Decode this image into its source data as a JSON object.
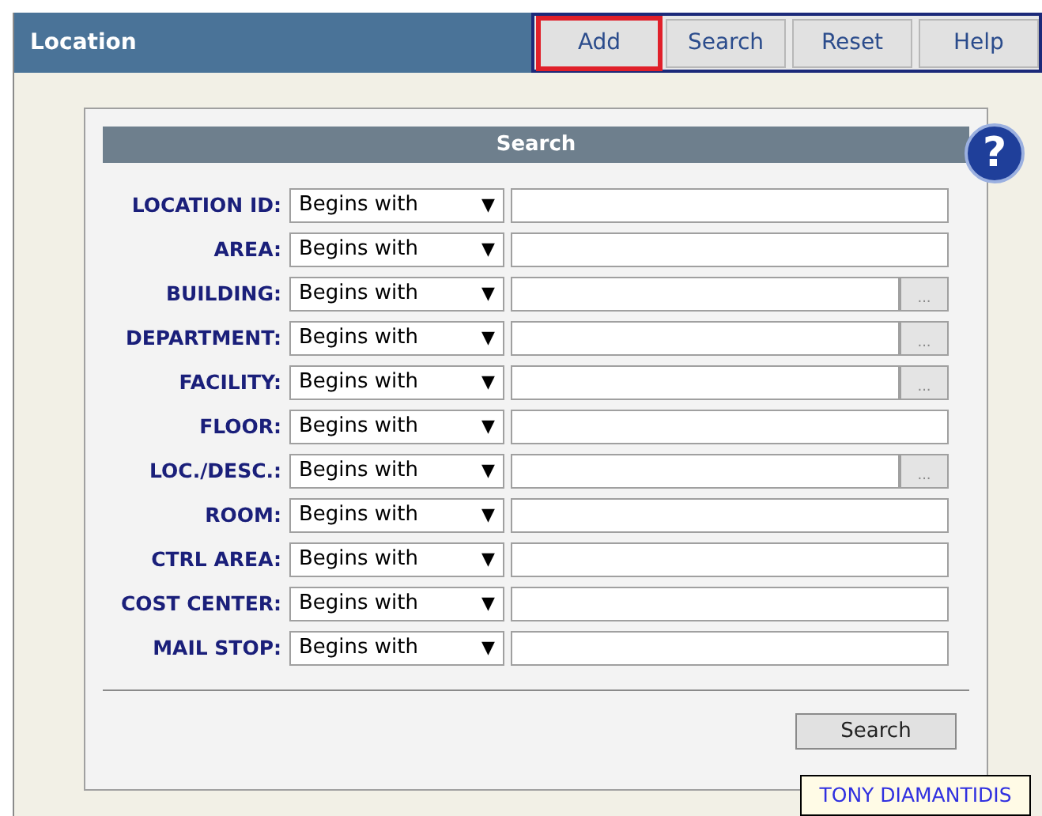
{
  "window": {
    "title": "Location"
  },
  "toolbar": [
    {
      "label": "Add",
      "highlighted": true
    },
    {
      "label": "Search",
      "highlighted": false
    },
    {
      "label": "Reset",
      "highlighted": false
    },
    {
      "label": "Help",
      "highlighted": false
    }
  ],
  "panel": {
    "title": "Search",
    "fields": [
      {
        "label": "LOCATION ID:",
        "operator": "Begins with",
        "lookup": false
      },
      {
        "label": "AREA:",
        "operator": "Begins with",
        "lookup": false
      },
      {
        "label": "BUILDING:",
        "operator": "Begins with",
        "lookup": true,
        "lookup_label": "..."
      },
      {
        "label": "DEPARTMENT:",
        "operator": "Begins with",
        "lookup": true,
        "lookup_label": "..."
      },
      {
        "label": "FACILITY:",
        "operator": "Begins with",
        "lookup": true,
        "lookup_label": "..."
      },
      {
        "label": "FLOOR:",
        "operator": "Begins with",
        "lookup": false
      },
      {
        "label": "LOC./DESC.:",
        "operator": "Begins with",
        "lookup": true,
        "lookup_label": "..."
      },
      {
        "label": "ROOM:",
        "operator": "Begins with",
        "lookup": false
      },
      {
        "label": "CTRL AREA:",
        "operator": "Begins with",
        "lookup": false
      },
      {
        "label": "COST CENTER:",
        "operator": "Begins with",
        "lookup": false
      },
      {
        "label": "MAIL STOP:",
        "operator": "Begins with",
        "lookup": false
      }
    ],
    "dropdown_arrow": "▼",
    "search_button": "Search"
  },
  "help_icon": "?",
  "tooltip": "TONY DIAMANTIDIS"
}
